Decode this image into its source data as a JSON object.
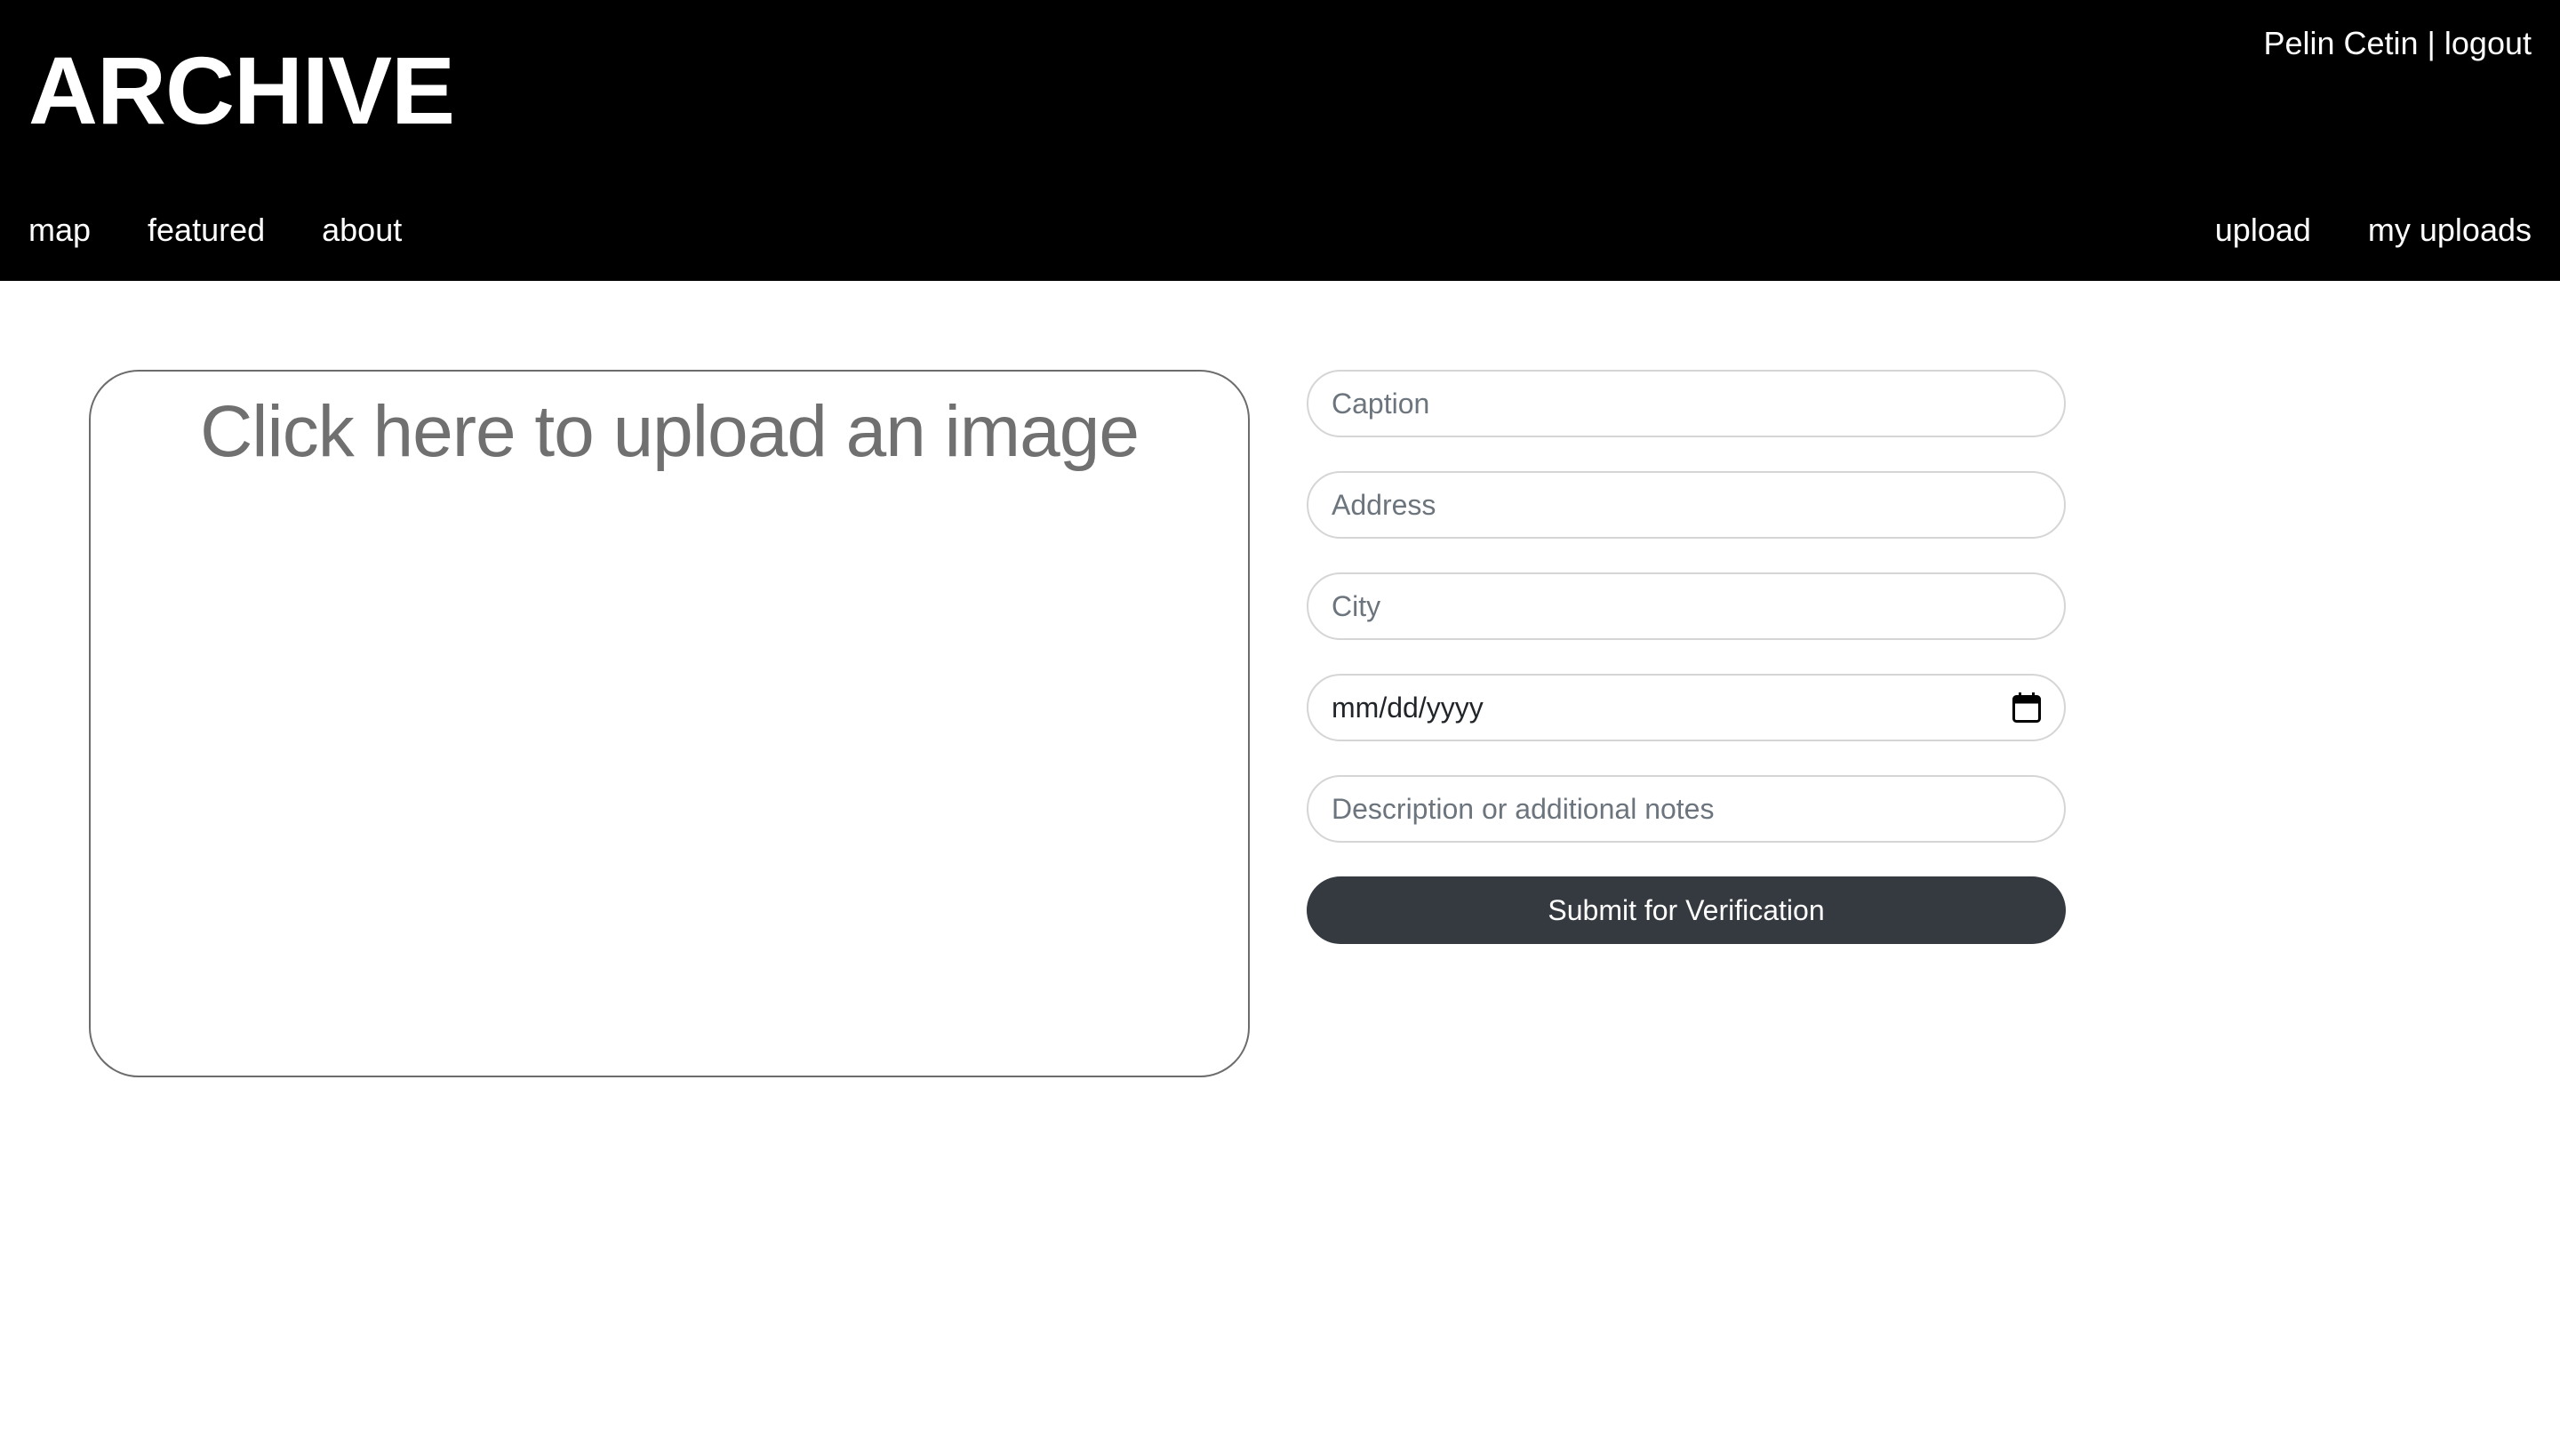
{
  "header": {
    "brand": "ARCHIVE",
    "user_name": "Pelin Cetin",
    "separator": " | ",
    "logout_label": "logout",
    "nav_left": [
      {
        "label": "map"
      },
      {
        "label": "featured"
      },
      {
        "label": "about"
      }
    ],
    "nav_right": [
      {
        "label": "upload"
      },
      {
        "label": "my uploads"
      }
    ]
  },
  "upload": {
    "prompt": "Click here to upload an image"
  },
  "form": {
    "caption_placeholder": "Caption",
    "address_placeholder": "Address",
    "city_placeholder": "City",
    "date_value": "mm/dd/yyyy",
    "date_icon": "calendar-icon",
    "notes_placeholder": "Description or additional notes",
    "submit_label": "Submit for Verification"
  },
  "colors": {
    "header_bg": "#000000",
    "button_bg": "#343a40",
    "field_border": "#d5d5d5"
  }
}
